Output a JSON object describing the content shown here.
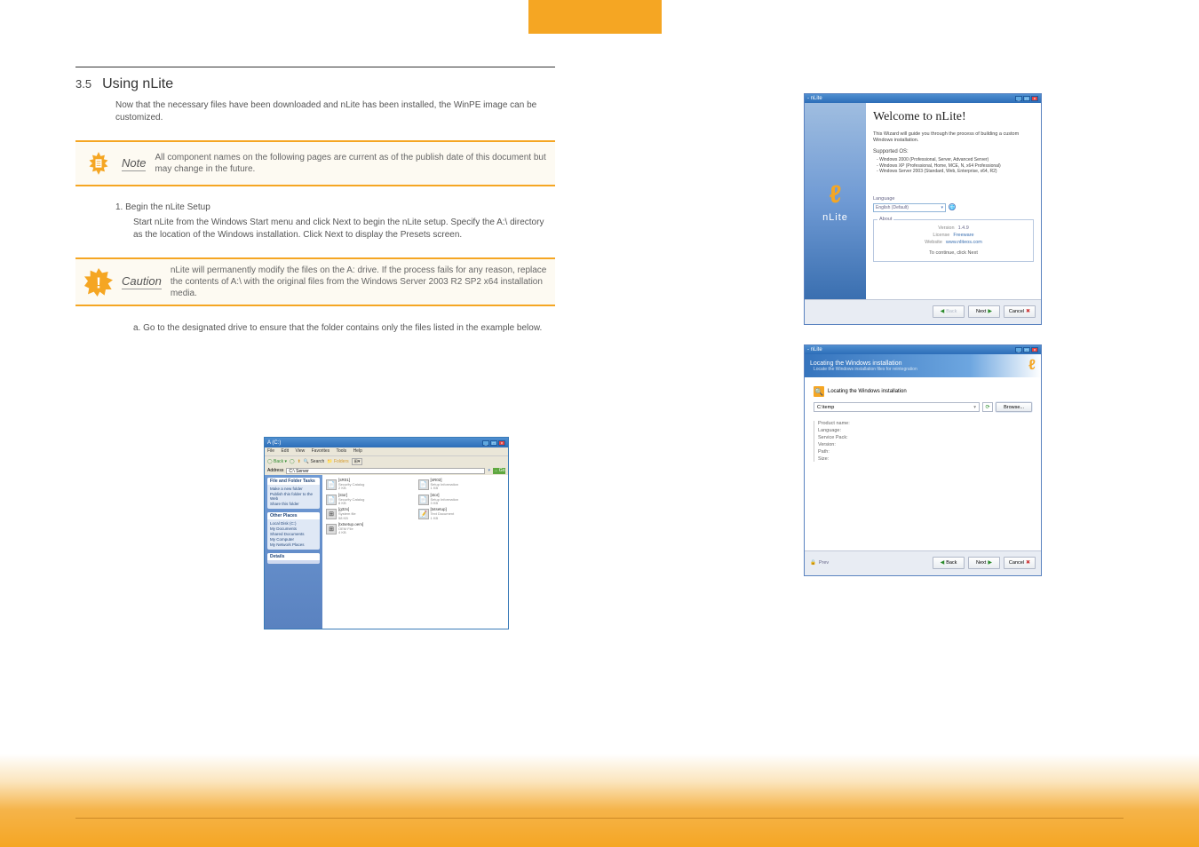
{
  "section": {
    "number": "3.5",
    "title": "Using nLite"
  },
  "intro": "Now that the necessary files have been downloaded and nLite has been installed, the WinPE image can be customized.",
  "note": {
    "label": "Note",
    "text": "All component names on the following pages are current as of the publish date of this document but may change in the future."
  },
  "step1": {
    "num": "1.",
    "title": "Begin the nLite Setup",
    "text": "Start nLite from the Windows Start menu and click Next to begin the nLite setup. Specify the A:\\ directory as the location of the Windows installation. Click Next to display the Presets screen."
  },
  "warn": {
    "label": "Caution",
    "text": "nLite will permanently modify the files on the A: drive. If the process fails for any reason, replace the contents of A:\\ with the original files from the Windows Server 2003 R2 SP2 x64 installation media."
  },
  "step_a": {
    "num": "a.",
    "text": "Go to the designated drive to ensure that the folder contains only the files listed in the example below."
  },
  "folder_window": {
    "title": "A (C:)",
    "menu": [
      "File",
      "Edit",
      "View",
      "Favorites",
      "Tools",
      "Help"
    ],
    "toolbar": {
      "back": "Back",
      "search": "Search",
      "folders": "Folders"
    },
    "address_label": "Address",
    "address_value": "C:\\ Server",
    "go": "Go",
    "sidebar": {
      "tasks_hdr": "File and Folder Tasks",
      "tasks": [
        "Make a new folder",
        "Publish this folder to the Web",
        "Share this folder"
      ],
      "other_hdr": "Other Places",
      "other": [
        "Local Disk (C:)",
        "My Documents",
        "Shared Documents",
        "My Computer",
        "My Network Places"
      ],
      "details_hdr": "Details"
    },
    "files": [
      {
        "name": "[sR01]",
        "sub": "Security Catalog",
        "size": "2 KB"
      },
      {
        "name": "[sR02]",
        "sub": "Setup Information",
        "size": "1 KB"
      },
      {
        "name": "[stor]",
        "sub": "Security Catalog",
        "size": "8 KB"
      },
      {
        "name": "[stor]",
        "sub": "Setup Information",
        "size": "3 KB"
      },
      {
        "name": "[g32x]",
        "sub": "System file",
        "size": "58 KB"
      },
      {
        "name": "[txtsetup]",
        "sub": "Text Document",
        "size": "1 KB"
      },
      {
        "name": "[txtsetup.oem]",
        "sub": "OEM File",
        "size": "4 KB"
      }
    ]
  },
  "nlite1": {
    "win_title": "nLite",
    "brand": "nLite",
    "welcome": "Welcome to nLite!",
    "intro_text": "This Wizard will guide you through the process of building a custom Windows installation.",
    "supported_hdr": "Supported OS:",
    "supported": [
      "Windows 2000 (Professional, Server, Advanced Server)",
      "Windows XP (Professional, Home, MCE, N, x64 Professional)",
      "Windows Server 2003 (Standard, Web, Enterprise, x64, R2)"
    ],
    "language_label": "Language",
    "language_value": "English (Default)",
    "about_label": "About",
    "version_k": "Version",
    "version_v": "1.4.9",
    "license_k": "License",
    "license_v": "Freeware",
    "website_k": "Website",
    "website_v": "www.nliteos.com",
    "continue": "To continue, click Next",
    "btn_back": "Back",
    "btn_next": "Next",
    "btn_cancel": "Cancel"
  },
  "nlite2": {
    "win_title": "nLite",
    "header_title": "Locating the Windows installation",
    "header_sub": "Locate the Windows installation files for reintegration",
    "locating": "Locating the Windows installation",
    "path": "C:\\temp",
    "browse": "Browse...",
    "info": [
      "Product name:",
      "Language:",
      "Service Pack:",
      "Version:",
      "Path:",
      "Size:"
    ],
    "prev_label": "Prev",
    "btn_back": "Back",
    "btn_next": "Next",
    "btn_cancel": "Cancel"
  }
}
